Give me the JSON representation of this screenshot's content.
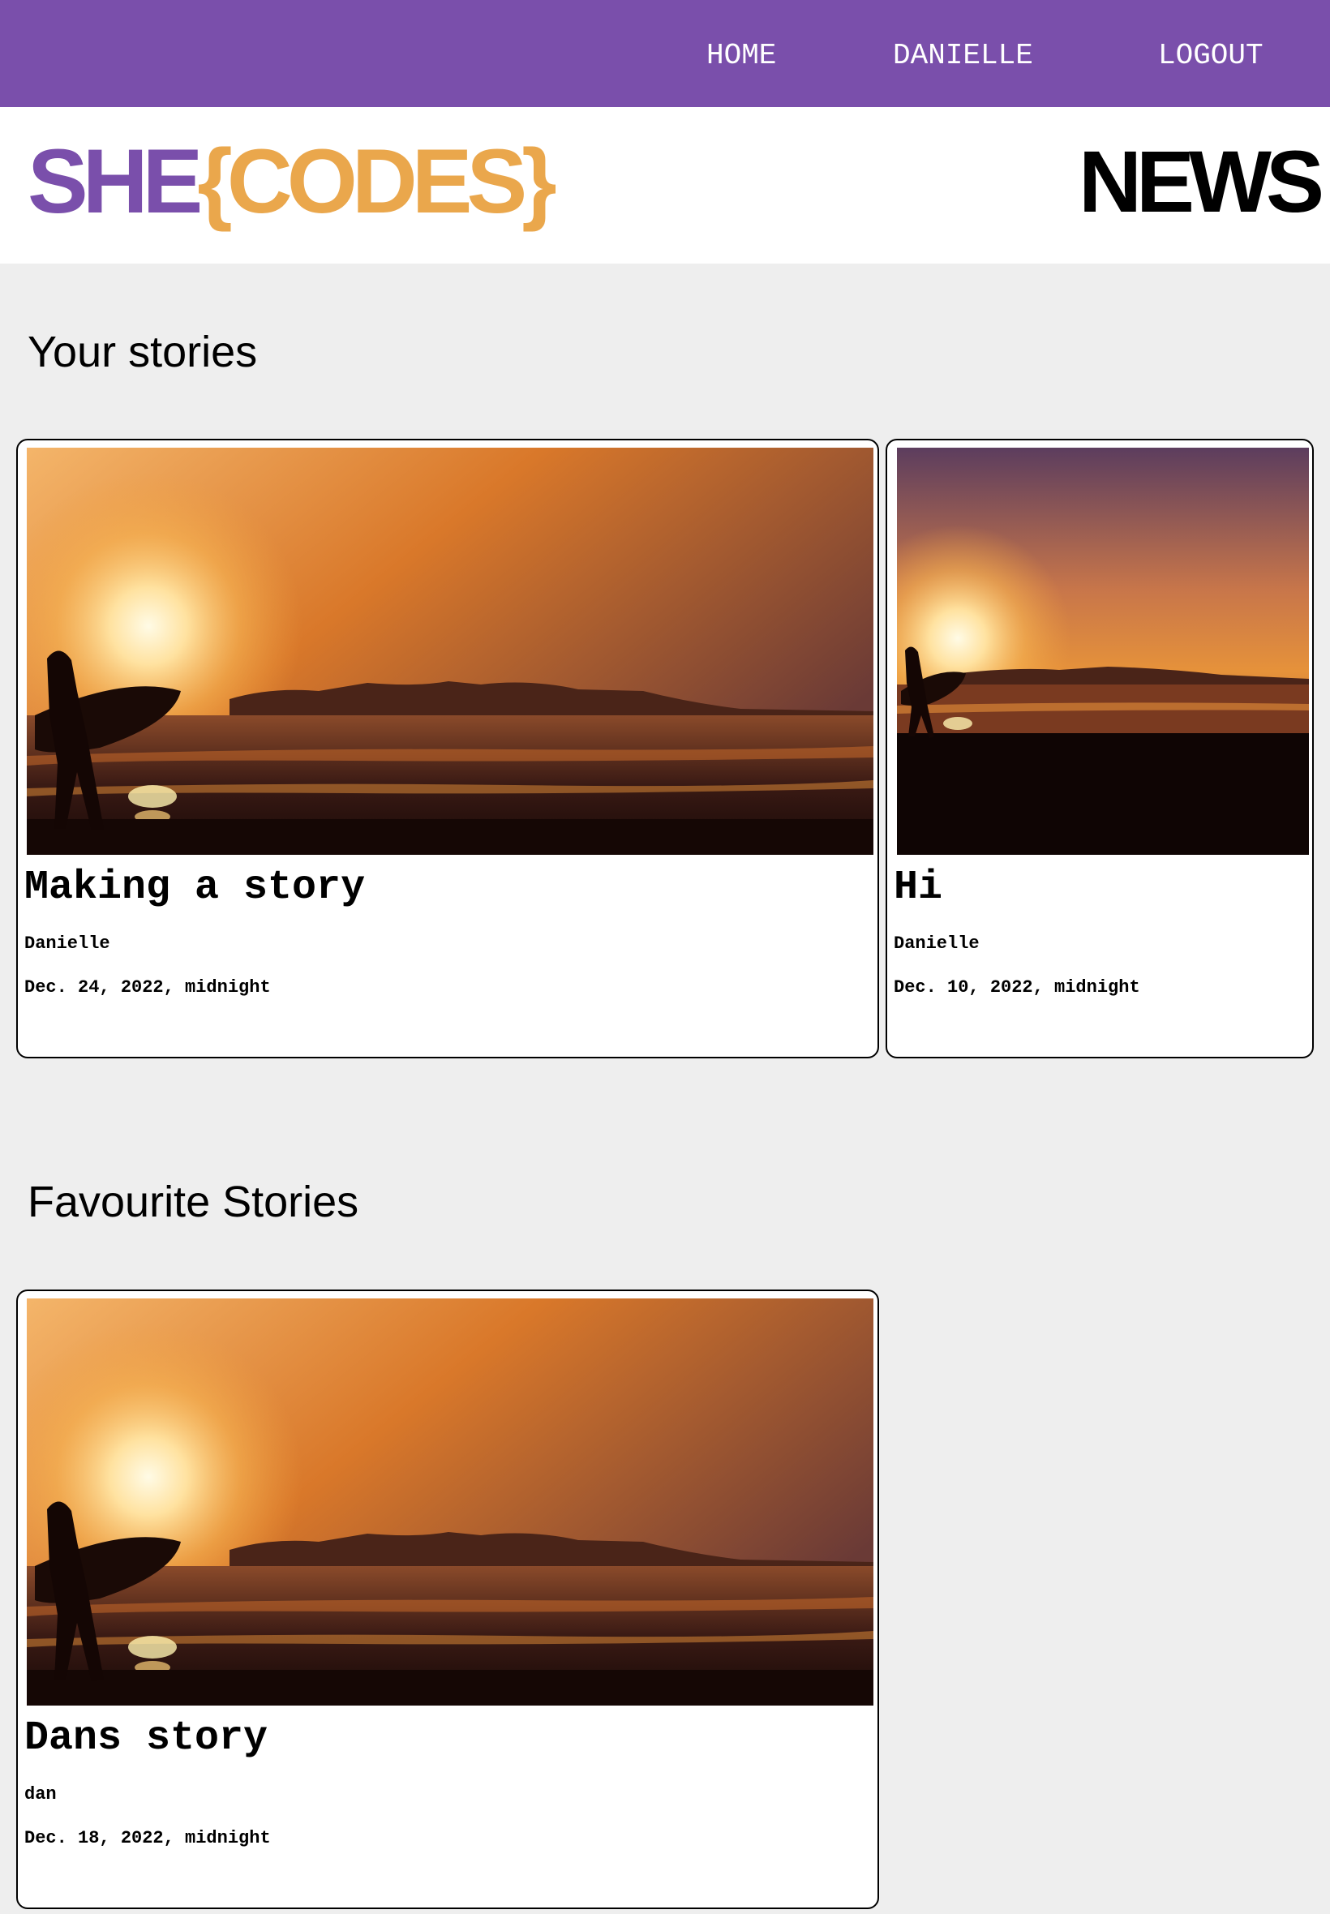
{
  "nav": {
    "home": "HOME",
    "user": "DANIELLE",
    "logout": "LOGOUT"
  },
  "brand": {
    "logo_she": "SHE",
    "logo_codes": "{CODES}",
    "news": "NEWS"
  },
  "colors": {
    "primary": "#7a4fab",
    "accent": "#eaa74c",
    "background": "#eeeeee"
  },
  "your_stories": {
    "heading": "Your stories",
    "cards": [
      {
        "title": "Making a story",
        "author": "Danielle",
        "date": "Dec. 24, 2022, midnight",
        "image": "sunset-surfer-photo"
      },
      {
        "title": "Hi",
        "author": "Danielle",
        "date": "Dec. 10, 2022, midnight",
        "image": "sunset-surfer-photo"
      }
    ]
  },
  "favourite_stories": {
    "heading": "Favourite Stories",
    "cards": [
      {
        "title": "Dans story",
        "author": "dan",
        "date": "Dec. 18, 2022, midnight",
        "image": "sunset-surfer-photo"
      }
    ]
  }
}
